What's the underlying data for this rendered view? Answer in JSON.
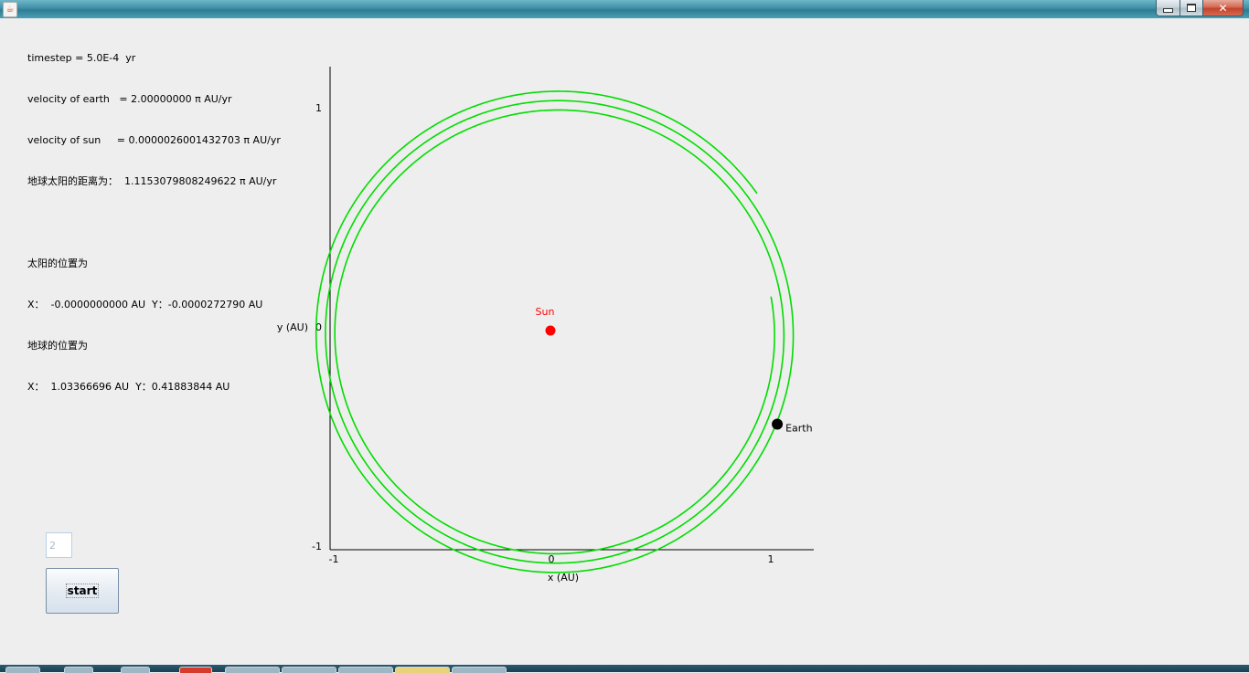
{
  "window": {
    "title": "",
    "app_icon": "java-cup-icon",
    "controls": [
      "minimize-icon",
      "maximize-icon",
      "close-icon"
    ]
  },
  "info": {
    "timestep": "timestep = 5.0E-4  yr",
    "velocity_earth": "velocity of earth   = 2.00000000 π AU/yr",
    "velocity_sun": "velocity of sun     = 0.0000026001432703 π AU/yr",
    "distance": "地球太阳的距离为：  1.1153079808249622 π AU/yr",
    "sun_position_label": "太阳的位置为",
    "sun_position": "X：  -0.0000000000 AU  Y：-0.0000272790 AU",
    "earth_position_label": "地球的位置为",
    "earth_position": "X：  1.03366696 AU  Y：0.41883844 AU"
  },
  "chart_data": {
    "type": "scatter",
    "xlabel": "x (AU)",
    "ylabel": "y (AU)",
    "xlim": [
      -1,
      1.2
    ],
    "ylim": [
      -1,
      1.2
    ],
    "x_ticks": [
      "-1",
      "0",
      "1"
    ],
    "y_ticks": [
      "1",
      "0",
      "-1"
    ],
    "sun": {
      "label": "Sun",
      "x": 0.0,
      "y": 0.0,
      "color": "#ff0000"
    },
    "earth": {
      "label": "Earth",
      "x": 1.03366696,
      "y": -0.41883844,
      "color": "#000000"
    },
    "orbit_trail": {
      "color": "#00dd00",
      "center_x": 0.03,
      "center_y": -0.025,
      "start_radius": 0.99,
      "end_radius": 1.115,
      "start_angle_deg": 10,
      "turns": 2.93
    }
  },
  "controls": {
    "input_value": "2",
    "start_label": "start"
  },
  "taskbar": {
    "items": [
      "start-orb",
      "chrome",
      "browser",
      "app-red",
      "explorer",
      "folder",
      "vs",
      "java",
      "window"
    ]
  }
}
